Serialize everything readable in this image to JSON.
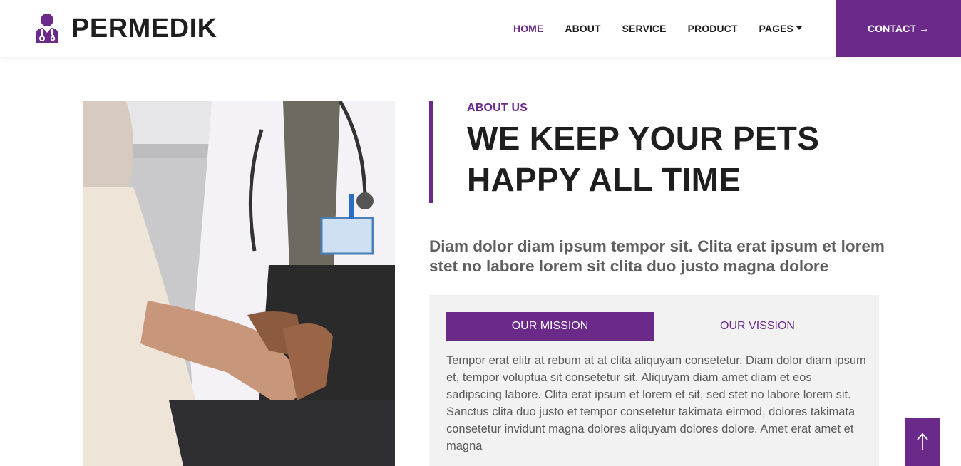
{
  "brand": {
    "name": "PERMEDIK",
    "icon": "doctor-icon"
  },
  "nav": {
    "items": [
      {
        "label": "HOME",
        "active": true
      },
      {
        "label": "ABOUT",
        "active": false
      },
      {
        "label": "SERVICE",
        "active": false
      },
      {
        "label": "PRODUCT",
        "active": false
      },
      {
        "label": "PAGES",
        "active": false,
        "dropdown": true
      }
    ],
    "contact_label": "CONTACT",
    "contact_icon": "arrow-right-icon"
  },
  "about": {
    "eyebrow": "ABOUT US",
    "headline_line1": "WE KEEP YOUR PETS",
    "headline_line2": "HAPPY ALL TIME",
    "lead": "Diam dolor diam ipsum tempor sit. Clita erat ipsum et lorem stet no labore lorem sit clita duo justo magna dolore",
    "tabs": [
      {
        "label": "OUR MISSION",
        "active": true
      },
      {
        "label": "OUR VISSION",
        "active": false
      }
    ],
    "tab_text": "Tempor erat elitr at rebum at at clita aliquyam consetetur. Diam dolor diam ipsum et, tempor voluptua sit consetetur sit. Aliquyam diam amet diam et eos sadipscing labore. Clita erat ipsum et lorem et sit, sed stet no labore lorem sit. Sanctus clita duo justo et tempor consetetur takimata eirmod, dolores takimata consetetur invidunt magna dolores aliquyam dolores dolore. Amet erat amet et magna"
  },
  "colors": {
    "primary": "#6b2a8a",
    "panel": "#f2f2f2",
    "text_dark": "#1e1e1e",
    "text_muted": "#5a5a5a"
  },
  "back_to_top_icon": "arrow-up-icon"
}
